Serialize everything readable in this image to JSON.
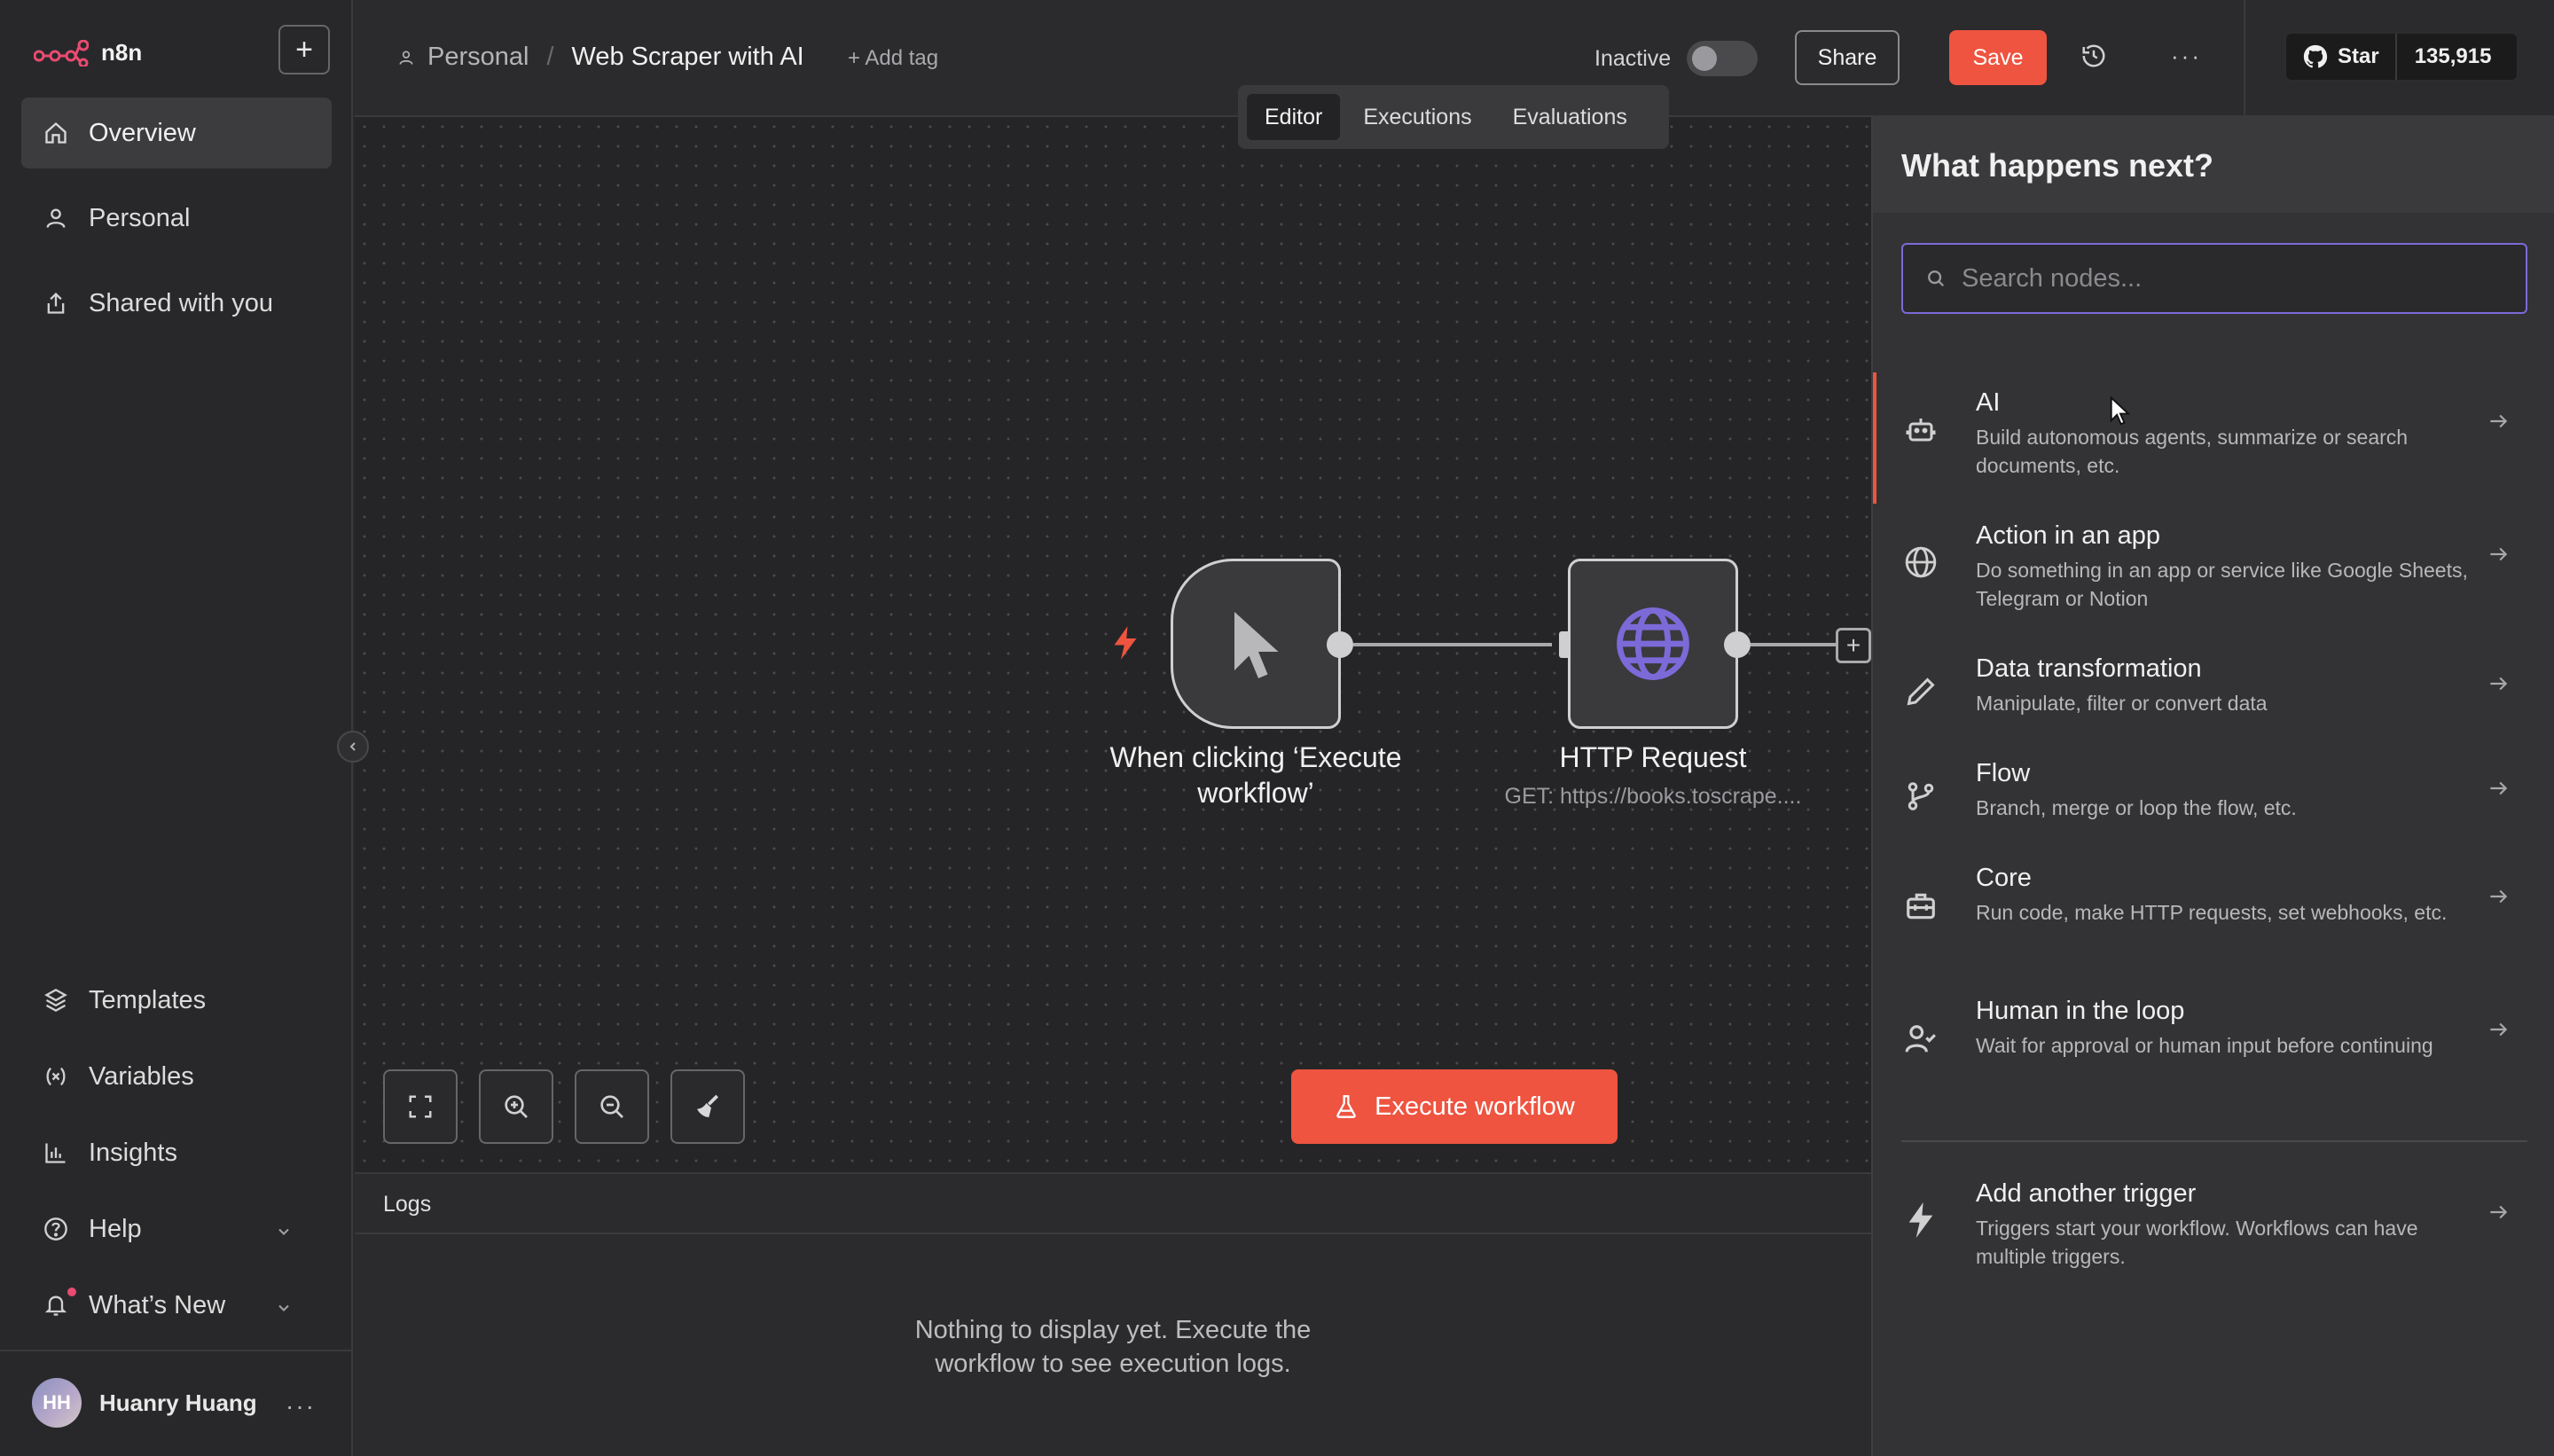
{
  "app": {
    "name": "n8n",
    "accent_color": "#ee5440",
    "focus_color": "#7c6ad8"
  },
  "sidebar": {
    "new_button_icon": "plus-icon",
    "nav_top": [
      {
        "label": "Overview",
        "icon": "home-icon"
      },
      {
        "label": "Personal",
        "icon": "user-icon"
      },
      {
        "label": "Shared with you",
        "icon": "share-icon"
      }
    ],
    "nav_bottom": [
      {
        "label": "Templates",
        "icon": "box-icon"
      },
      {
        "label": "Variables",
        "icon": "variable-icon"
      },
      {
        "label": "Insights",
        "icon": "chart-icon"
      },
      {
        "label": "Help",
        "icon": "help-icon"
      },
      {
        "label": "What’s New",
        "icon": "bell-icon"
      }
    ],
    "user": {
      "initials": "HH",
      "name": "Huanry Huang"
    }
  },
  "header": {
    "breadcrumb_project": "Personal",
    "workflow_title": "Web Scraper with AI",
    "add_tag": "+ Add tag",
    "status_label": "Inactive",
    "share_label": "Share",
    "save_label": "Save",
    "github": {
      "label": "Star",
      "count": "135,915"
    }
  },
  "tabs": [
    "Editor",
    "Executions",
    "Evaluations"
  ],
  "canvas": {
    "nodes": [
      {
        "label": "When clicking ‘Execute workflow’",
        "subtitle": "",
        "icon": "cursor-pointer-icon"
      },
      {
        "label": "HTTP Request",
        "subtitle": "GET: https://books.toscrape....",
        "icon": "globe-icon"
      }
    ],
    "execute_label": "Execute workflow"
  },
  "logs": {
    "title": "Logs",
    "empty_line1": "Nothing to display yet. Execute the",
    "empty_line2": "workflow to see execution logs."
  },
  "panel": {
    "title": "What happens next?",
    "search_placeholder": "Search nodes...",
    "categories": [
      {
        "title": "AI",
        "desc": "Build autonomous agents, summarize or search documents, etc.",
        "icon": "robot-icon"
      },
      {
        "title": "Action in an app",
        "desc": "Do something in an app or service like Google Sheets, Telegram or Notion",
        "icon": "globe-icon"
      },
      {
        "title": "Data transformation",
        "desc": "Manipulate, filter or convert data",
        "icon": "pen-icon"
      },
      {
        "title": "Flow",
        "desc": "Branch, merge or loop the flow, etc.",
        "icon": "branch-icon"
      },
      {
        "title": "Core",
        "desc": "Run code, make HTTP requests, set webhooks, etc.",
        "icon": "toolbox-icon"
      },
      {
        "title": "Human in the loop",
        "desc": "Wait for approval or human input before continuing",
        "icon": "user-check-icon"
      }
    ],
    "trigger": {
      "title": "Add another trigger",
      "desc": "Triggers start your workflow. Workflows can have multiple triggers.",
      "icon": "bolt-icon"
    }
  }
}
